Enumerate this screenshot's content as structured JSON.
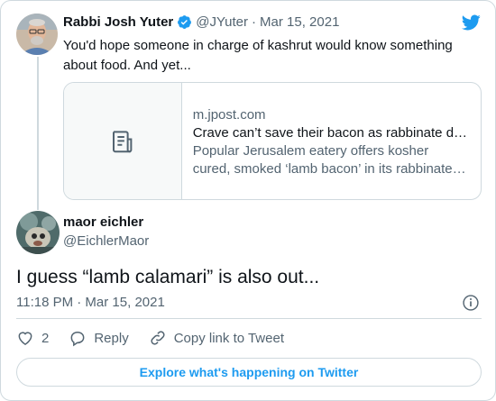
{
  "colors": {
    "accent": "#1d9bf0",
    "text": "#0f1419",
    "muted": "#536471",
    "border": "#cfd9de"
  },
  "original_tweet": {
    "author_name": "Rabbi Josh Yuter",
    "verified": true,
    "handle": "@JYuter",
    "separator": "·",
    "date": "Mar 15, 2021",
    "text": "You'd hope someone in charge of kashrut would know something about food. And yet...",
    "link_card": {
      "icon": "document-icon",
      "domain": "m.jpost.com",
      "title": "Crave can’t save their bacon as rabbinate d…",
      "description": "Popular Jerusalem eatery offers kosher cured, smoked ‘lamb bacon’ in its rabbinate licens…"
    }
  },
  "reply_tweet": {
    "author_name": "maor eichler",
    "handle": "@EichlerMaor",
    "text": "I guess “lamb calamari” is also out...",
    "timestamp": "11:18 PM · Mar 15, 2021"
  },
  "actions": {
    "like_count": "2",
    "reply_label": "Reply",
    "copy_label": "Copy link to Tweet"
  },
  "explore_label": "Explore what's happening on Twitter"
}
